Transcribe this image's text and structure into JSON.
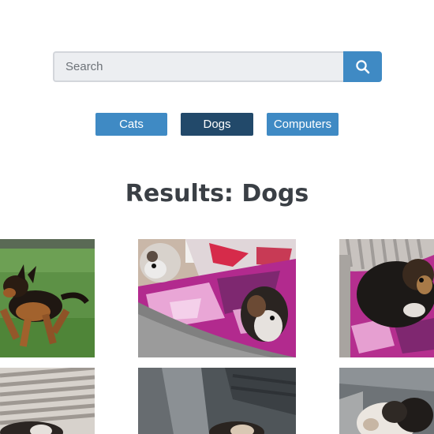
{
  "search": {
    "placeholder": "Search",
    "button_icon": "search-icon"
  },
  "filters": [
    {
      "label": "Cats",
      "active": false
    },
    {
      "label": "Dogs",
      "active": true
    },
    {
      "label": "Computers",
      "active": false
    }
  ],
  "results": {
    "title": "Results: Dogs"
  },
  "photos": [
    "running-dog-photo",
    "dogs-on-pink-blanket-photo",
    "black-dog-on-blanket-photo",
    "dog-on-striped-cushion-photo",
    "dog-on-gray-couch-photo",
    "fluffy-dog-photo"
  ],
  "colors": {
    "accent": "#3f8ac4",
    "active": "#22496a",
    "title": "#3a3f45"
  }
}
